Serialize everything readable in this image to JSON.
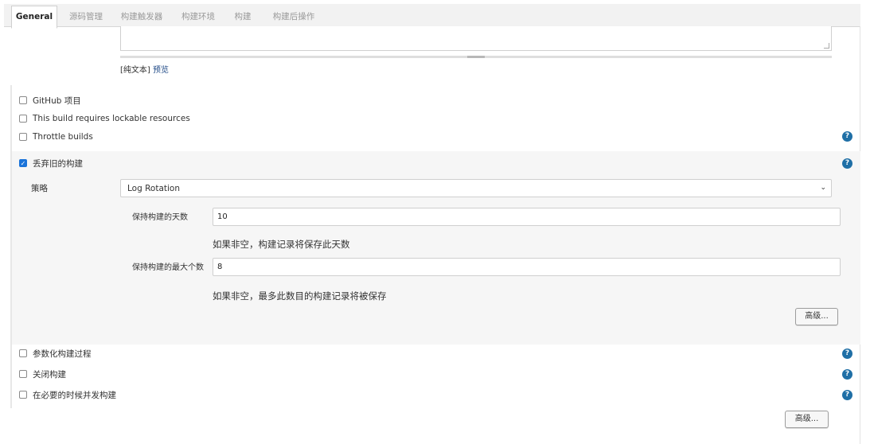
{
  "tabs": [
    {
      "label": "General",
      "active": true
    },
    {
      "label": "源码管理",
      "active": false
    },
    {
      "label": "构建触发器",
      "active": false
    },
    {
      "label": "构建环境",
      "active": false
    },
    {
      "label": "构建",
      "active": false
    },
    {
      "label": "构建后操作",
      "active": false
    }
  ],
  "description": {
    "value": "",
    "format_text": "[纯文本]",
    "preview_link": "预览"
  },
  "options_top": [
    {
      "label": "GitHub 项目",
      "checked": false
    },
    {
      "label": "This build requires lockable resources",
      "checked": false
    },
    {
      "label": "Throttle builds",
      "checked": false
    }
  ],
  "discard": {
    "label": "丢弃旧的构建",
    "checked": true,
    "strategy_label": "策略",
    "strategy_value": "Log Rotation",
    "days_label": "保持构建的天数",
    "days_value": "10",
    "days_hint": "如果非空，构建记录将保存此天数",
    "max_label": "保持构建的最大个数",
    "max_value": "8",
    "max_hint": "如果非空，最多此数目的构建记录将被保存",
    "advanced_label": "高级..."
  },
  "options_bottom": [
    {
      "label": "参数化构建过程",
      "checked": false
    },
    {
      "label": "关闭构建",
      "checked": false
    },
    {
      "label": "在必要的时候并发构建",
      "checked": false
    }
  ],
  "advanced_label": "高级...",
  "help_icon_text": "?",
  "checkmark_text": "✓",
  "colors": {
    "accent": "#1a73d9",
    "help": "#1f6fa6",
    "link": "#204a87"
  }
}
